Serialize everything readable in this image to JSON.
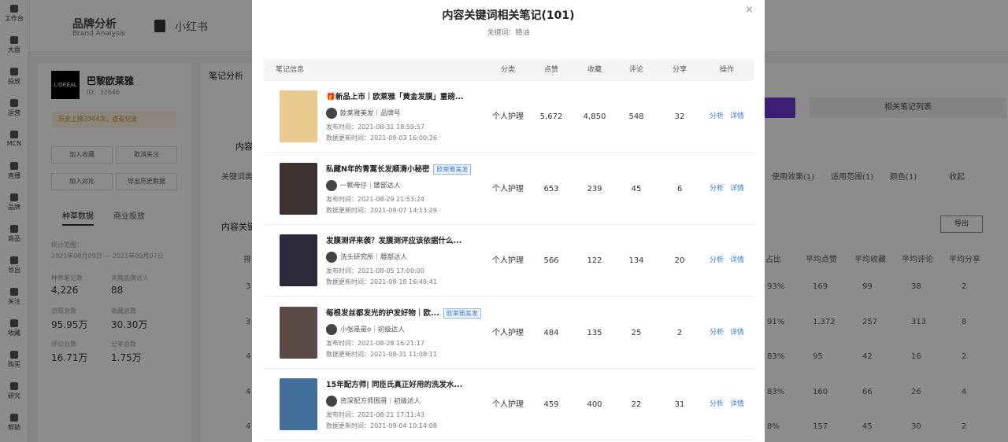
{
  "left_nav": [
    {
      "label": "工作台"
    },
    {
      "label": "大盘"
    },
    {
      "label": "投放"
    },
    {
      "label": "运营"
    },
    {
      "label": "MCN"
    },
    {
      "label": "直播"
    },
    {
      "label": "品牌"
    },
    {
      "label": "商品"
    },
    {
      "label": "导出"
    },
    {
      "label": "关注"
    },
    {
      "label": "收藏"
    },
    {
      "label": "购买"
    },
    {
      "label": "研究"
    },
    {
      "label": "帮助"
    }
  ],
  "header": {
    "title": "品牌分析",
    "subtitle": "Brand Analysis",
    "platform_tab": "小红书"
  },
  "brand": {
    "logo_text": "L'ORÉAL",
    "name": "巴黎欧莱雅",
    "id": "ID：32646",
    "history_notice": "历史上榜3344次，查看记录",
    "btn_add_favorite": "加入收藏",
    "btn_unfollow": "取消关注",
    "btn_compare": "加入对比",
    "btn_export_history": "导出历史数据",
    "tab_grass": "种草数据",
    "tab_commercial": "商业投放",
    "stats_range_label": "统计范围：",
    "stats_range": "2021年08月09日 — 2021年09月07日",
    "stats": [
      {
        "label": "种草笔记数",
        "value": "4,226"
      },
      {
        "label": "关联品牌达人",
        "value": "88"
      },
      {
        "label": "点赞总数",
        "value": "95.95万"
      },
      {
        "label": "收藏总数",
        "value": "30.30万"
      },
      {
        "label": "评论总数",
        "value": "16.71万"
      },
      {
        "label": "分享总数",
        "value": "1.75万"
      }
    ]
  },
  "background": {
    "tab_note_analysis": "笔记分析",
    "section_content": "内容",
    "keyword_cat": "关键词类",
    "filters": [
      "使用效果(1)",
      "适用范围(1)",
      "颜色(1)"
    ],
    "collapse": "收起",
    "section_keywords": "内容关键",
    "related_list_btn": "相关笔记列表",
    "export_btn": "导出",
    "col_rank": "排",
    "right_headers": [
      "占比",
      "平均点赞",
      "平均收藏",
      "平均评论",
      "平均分享"
    ],
    "right_rows": [
      [
        "3",
        "93%",
        "169",
        "99",
        "38",
        "2"
      ],
      [
        "3",
        "91%",
        "1,372",
        "257",
        "313",
        "8"
      ],
      [
        "4",
        "83%",
        "95",
        "42",
        "16",
        "2"
      ],
      [
        "4",
        "83%",
        "160",
        "66",
        "26",
        "4"
      ],
      [
        "4",
        "8%",
        "157",
        "45",
        "30",
        "2"
      ]
    ]
  },
  "modal": {
    "title": "内容关键词相关笔记(101)",
    "keyword_label": "关键词：",
    "keyword": "精油",
    "close_label": "×",
    "columns": [
      "笔记信息",
      "分类",
      "点赞",
      "收藏",
      "评论",
      "分享",
      "操作"
    ],
    "op_analyze": "分析",
    "op_detail": "详情",
    "published_label": "发布时间：",
    "updated_label": "数据更新时间：",
    "notes": [
      {
        "title": "🎁新品上市｜欧莱雅「黄金发膜」重磅...",
        "tag": "",
        "author": "欧莱雅美发｜品牌号",
        "published": "2021-08-31 18:59:57",
        "updated": "2021-09-03 16:00:26",
        "category": "个人护理",
        "likes": "5,672",
        "favorites": "4,850",
        "comments": "548",
        "shares": "32",
        "thumb_color": "#e9c98e"
      },
      {
        "title": "私藏N年的青蒿长发顺滑小秘密",
        "tag": "欧莱雅美发",
        "author": "一颗帝仔｜腰部达人",
        "published": "2021-08-29 21:53:24",
        "updated": "2021-09-07 14:13:29",
        "category": "个人护理",
        "likes": "653",
        "favorites": "239",
        "comments": "45",
        "shares": "6",
        "thumb_color": "#3d3330"
      },
      {
        "title": "发膜测评来袭？发膜测评应该依据什么...",
        "tag": "",
        "author": "洗头研究所｜腰部达人",
        "published": "2021-08-05 17:00:00",
        "updated": "2021-08-18 16:49:41",
        "category": "个人护理",
        "likes": "566",
        "favorites": "122",
        "comments": "134",
        "shares": "20",
        "thumb_color": "#2a2a3a"
      },
      {
        "title": "每根发丝都发光的护发好物｜欧...",
        "tag": "欧莱雅美发",
        "author": "小张是是o｜初级达人",
        "published": "2021-08-28 16:21:17",
        "updated": "2021-08-31 11:08:11",
        "category": "个人护理",
        "likes": "484",
        "favorites": "135",
        "comments": "25",
        "shares": "2",
        "thumb_color": "#5a4a48"
      },
      {
        "title": "15年配方师| 同臣氏真正好用的洗发水...",
        "tag": "",
        "author": "资深配方师围哥｜初级达人",
        "published": "2021-08-21 17:11:43",
        "updated": "2021-09-04 10:14:08",
        "category": "个人护理",
        "likes": "459",
        "favorites": "400",
        "comments": "22",
        "shares": "31",
        "thumb_color": "#3f6f9a"
      }
    ]
  }
}
